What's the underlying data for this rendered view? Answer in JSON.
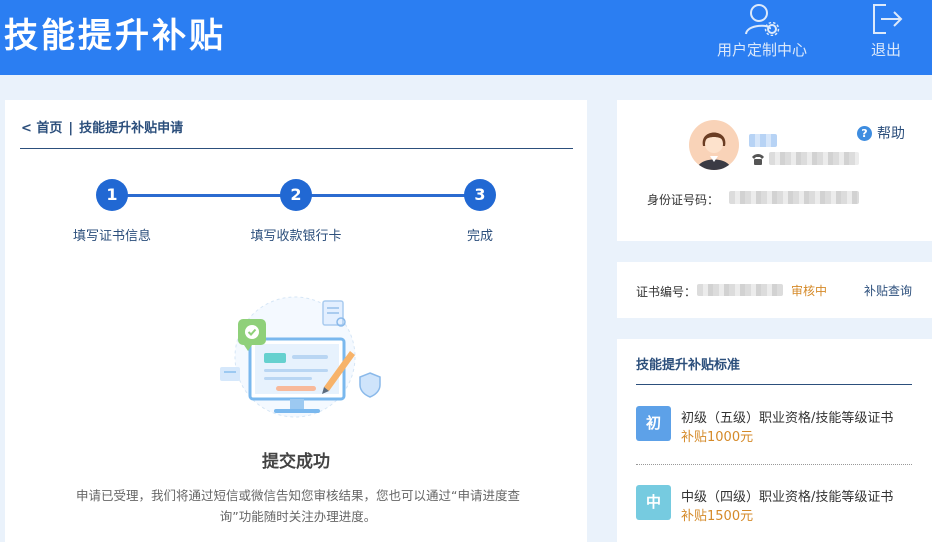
{
  "header": {
    "title": "技能提升补贴",
    "user_center_label": "用户定制中心",
    "logout_label": "退出"
  },
  "breadcrumb": {
    "home": "< 首页",
    "separator": "|",
    "current": "技能提升补贴申请"
  },
  "steps": [
    {
      "number": "1",
      "label": "填写证书信息"
    },
    {
      "number": "2",
      "label": "填写收款银行卡"
    },
    {
      "number": "3",
      "label": "完成"
    }
  ],
  "result": {
    "title": "提交成功",
    "description": "申请已受理，我们将通过短信或微信告知您审核结果，您也可以通过“申请进度查询”功能随时关注办理进度。"
  },
  "user": {
    "help_label": "帮助",
    "id_label": "身份证号码："
  },
  "certificate": {
    "label": "证书编号：",
    "status": "审核中",
    "link": "补贴查询"
  },
  "standards": {
    "title": "技能提升补贴标准",
    "items": [
      {
        "badge": "初",
        "name": "初级（五级）职业资格/技能等级证书",
        "amount": "补贴1000元",
        "color": "#5da1e8"
      },
      {
        "badge": "中",
        "name": "中级（四级）职业资格/技能等级证书",
        "amount": "补贴1500元",
        "color": "#76cbe0"
      }
    ]
  },
  "colors": {
    "header_bg": "#2b7ef2",
    "accent": "#2168d3",
    "status_orange": "#d58a29"
  }
}
